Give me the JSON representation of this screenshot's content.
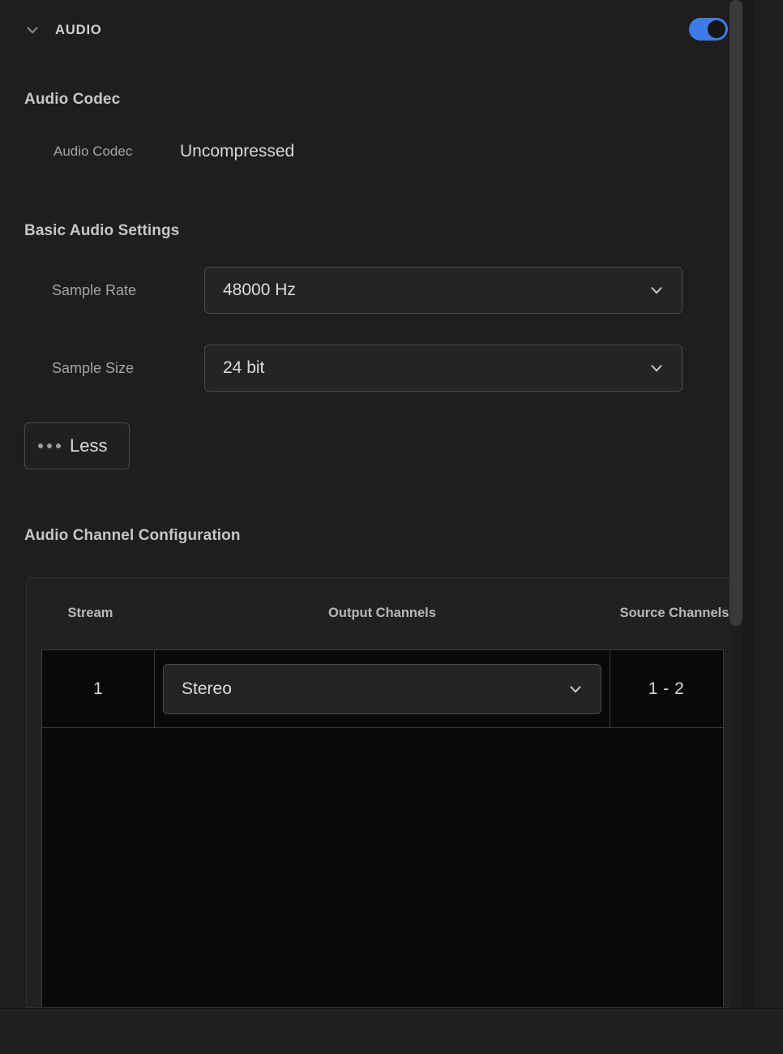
{
  "section": {
    "title": "AUDIO",
    "collapse_icon": "chevron-down-icon",
    "toggle": {
      "enabled": true,
      "color": "#3d7ce8"
    }
  },
  "audio_codec": {
    "heading": "Audio Codec",
    "rows": [
      {
        "label": "Audio Codec",
        "value": "Uncompressed"
      }
    ]
  },
  "basic_audio_settings": {
    "heading": "Basic Audio Settings",
    "fields": [
      {
        "label": "Sample Rate",
        "value": "48000 Hz",
        "icon": "chevron-down-icon"
      },
      {
        "label": "Sample Size",
        "value": "24 bit",
        "icon": "chevron-down-icon"
      }
    ],
    "less_button": {
      "label": "Less",
      "icon": "ellipsis-icon"
    }
  },
  "audio_channel_configuration": {
    "heading": "Audio Channel Configuration",
    "columns": [
      "Stream",
      "Output Channels",
      "Source Channels"
    ],
    "rows": [
      {
        "stream": "1",
        "output_channels": "Stereo",
        "source_channels": "1 - 2"
      }
    ]
  },
  "scrollbar": {
    "orientation": "vertical",
    "thumb_color": "#3a3a3a"
  }
}
